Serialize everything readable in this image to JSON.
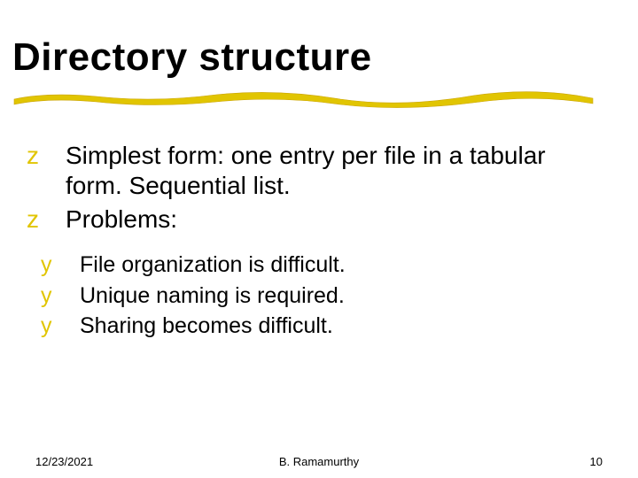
{
  "title": "Directory structure",
  "bullets": {
    "zglyph": "z",
    "yglyph": "y",
    "l1a": "Simplest form: one entry per file in a tabular form. Sequential list.",
    "l1b": "Problems:",
    "l2a": "File organization is difficult.",
    "l2b": "Unique naming is required.",
    "l2c": "Sharing becomes difficult."
  },
  "footer": {
    "date": "12/23/2021",
    "author": "B. Ramamurthy",
    "page": "10"
  },
  "colors": {
    "accent": "#e1c502"
  }
}
